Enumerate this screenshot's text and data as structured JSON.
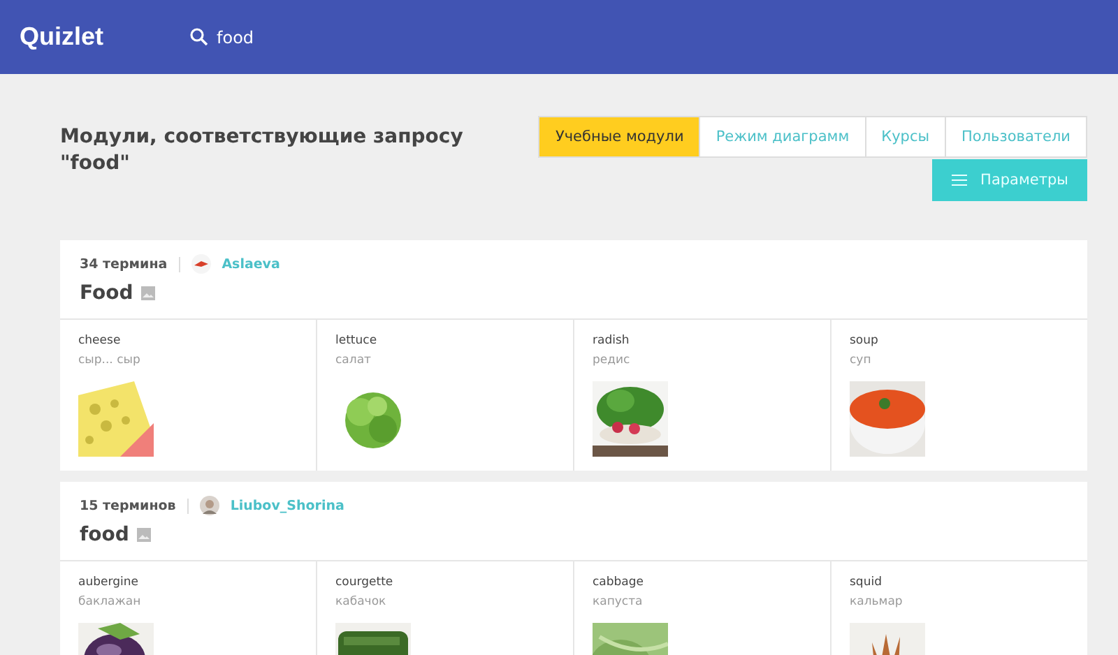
{
  "header": {
    "logo": "Quizlet",
    "search": {
      "value": "food"
    }
  },
  "results_title": "Модули, соответствующие запросу \"food\"",
  "tabs": [
    {
      "label": "Учебные модули",
      "selected": true
    },
    {
      "label": "Режим диаграмм",
      "selected": false
    },
    {
      "label": "Курсы",
      "selected": false
    },
    {
      "label": "Пользователи",
      "selected": false
    }
  ],
  "options_button": "Параметры",
  "sets": [
    {
      "term_count": "34 термина",
      "author": "Aslaeva",
      "title": "Food",
      "terms": [
        {
          "term": "cheese",
          "definition": "сыр... сыр",
          "kind": "picture"
        },
        {
          "term": "lettuce",
          "definition": "салат",
          "kind": "picture"
        },
        {
          "term": "radish",
          "definition": "редис",
          "kind": "picture"
        },
        {
          "term": "soup",
          "definition": "суп",
          "kind": "picture"
        }
      ]
    },
    {
      "term_count": "15 терминов",
      "author": "Liubov_Shorina",
      "title": "food",
      "terms": [
        {
          "term": "aubergine",
          "definition": "баклажан",
          "kind": "picture"
        },
        {
          "term": "courgette",
          "definition": "кабачок",
          "kind": "picture"
        },
        {
          "term": "cabbage",
          "definition": "капуста",
          "kind": "picture"
        },
        {
          "term": "squid",
          "definition": "кальмар",
          "kind": "picture"
        }
      ]
    }
  ]
}
